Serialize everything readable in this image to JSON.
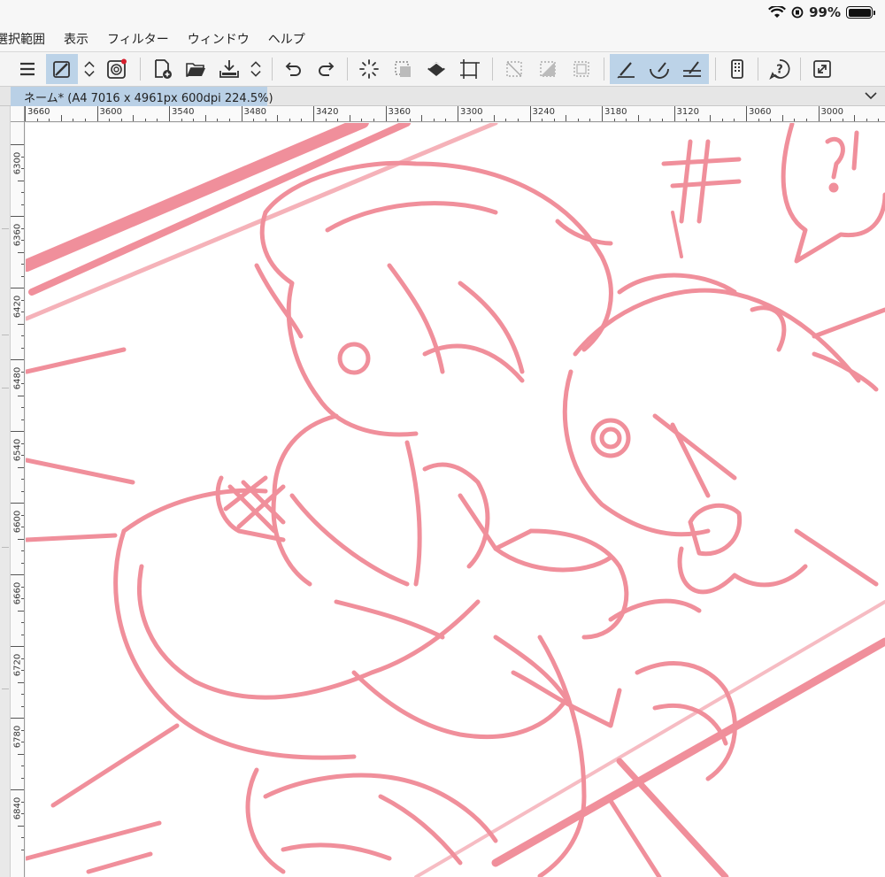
{
  "status": {
    "battery_text": "99%"
  },
  "menu": [
    "選択範囲",
    "表示",
    "フィルター",
    "ウィンドウ",
    "ヘルプ"
  ],
  "toolbar": {
    "icons": [
      "hamburger-menu-icon",
      "pen-stroke-icon",
      "chevron-updown-icon",
      "spiral-record-icon",
      "new-page-icon",
      "open-folder-icon",
      "save-download-icon",
      "chevron-updown-icon",
      "undo-icon",
      "redo-icon",
      "loading-spinner-icon",
      "selection-clear-icon",
      "fill-bucket-icon",
      "transform-crop-icon",
      "deselect-icon",
      "invert-selection-icon",
      "selection-frame-icon",
      "ruler-pen-icon",
      "curve-ruler-icon",
      "perspective-ruler-icon",
      "device-panel-icon",
      "help-icon",
      "fullscreen-icon"
    ]
  },
  "document": {
    "tab_title": "ネーム* (A4 7016 x 4961px 600dpi 224.5%)"
  },
  "ruler": {
    "top_labels": [
      "3660",
      "3600",
      "3540",
      "3480",
      "3420",
      "3360",
      "3300",
      "3240",
      "3180",
      "3120",
      "3060",
      "3000"
    ],
    "left_labels": [
      "6300",
      "6360",
      "6420",
      "6480",
      "6540",
      "6600",
      "6660",
      "6720",
      "6780",
      "6840"
    ]
  },
  "colors": {
    "sketch": "#f08a96",
    "selected_tool": "#bcd3e8"
  }
}
